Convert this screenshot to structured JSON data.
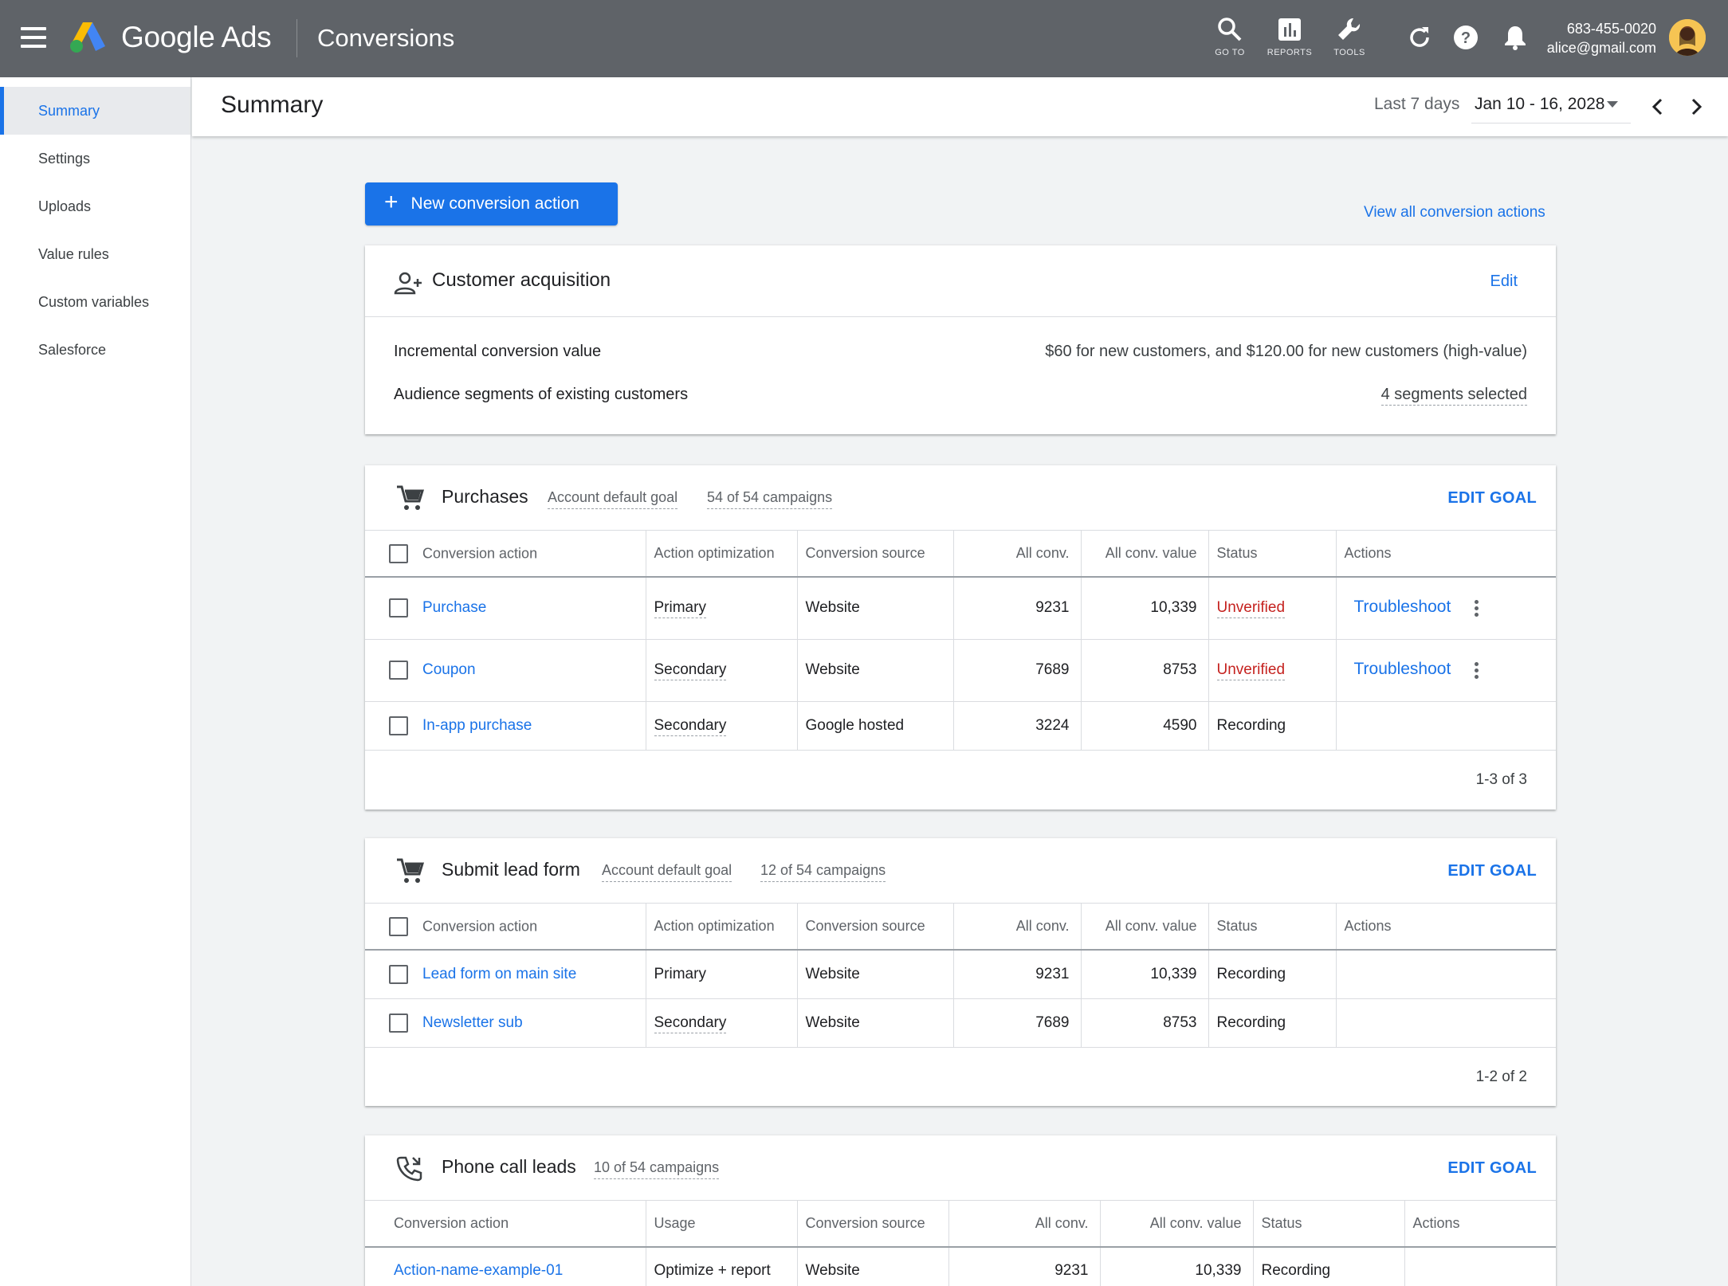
{
  "app": {
    "brand": "Google Ads",
    "section": "Conversions"
  },
  "topbar": {
    "tools": [
      {
        "label": "GO TO",
        "icon": "search-icon"
      },
      {
        "label": "REPORTS",
        "icon": "reports-icon"
      },
      {
        "label": "TOOLS",
        "icon": "wrench-icon"
      }
    ],
    "account": {
      "phone": "683-455-0020",
      "email": "alice@gmail.com"
    }
  },
  "sidebar": {
    "items": [
      {
        "label": "Summary",
        "active": true
      },
      {
        "label": "Settings"
      },
      {
        "label": "Uploads"
      },
      {
        "label": "Value rules"
      },
      {
        "label": "Custom variables"
      },
      {
        "label": "Salesforce"
      }
    ]
  },
  "header": {
    "title": "Summary",
    "date_label": "Last 7 days",
    "date_range": "Jan 10 - 16, 2028"
  },
  "main": {
    "new_button": "New conversion action",
    "view_all": "View all conversion actions"
  },
  "customer_acquisition": {
    "title": "Customer acquisition",
    "edit": "Edit",
    "rows": [
      {
        "label": "Incremental conversion value",
        "value": "$60 for new customers, and $120.00 for new customers (high-value)"
      },
      {
        "label": "Audience segments of existing customers",
        "value": "4 segments selected"
      }
    ]
  },
  "purchases": {
    "title": "Purchases",
    "chip1": "Account default goal",
    "chip2": "54 of 54 campaigns",
    "edit_goal": "EDIT GOAL",
    "columns": [
      "Conversion action",
      "Action optimization",
      "Conversion source",
      "All conv.",
      "All conv. value",
      "Status",
      "Actions"
    ],
    "rows": [
      {
        "action": "Purchase",
        "optimization": "Primary",
        "source": "Website",
        "conv": "9231",
        "value": "10,339",
        "status": "Unverified",
        "actions": "Troubleshoot"
      },
      {
        "action": "Coupon",
        "optimization": "Secondary",
        "source": "Website",
        "conv": "7689",
        "value": "8753",
        "status": "Unverified",
        "actions": "Troubleshoot"
      },
      {
        "action": "In-app purchase",
        "optimization": "Secondary",
        "source": "Google hosted",
        "conv": "3224",
        "value": "4590",
        "status": "Recording",
        "actions": ""
      }
    ],
    "pager": "1-3 of 3"
  },
  "lead_form": {
    "title": "Submit lead form",
    "chip1": "Account default goal",
    "chip2": "12 of 54 campaigns",
    "edit_goal": "EDIT GOAL",
    "columns": [
      "Conversion action",
      "Action optimization",
      "Conversion source",
      "All conv.",
      "All conv. value",
      "Status",
      "Actions"
    ],
    "rows": [
      {
        "action": "Lead form on main site",
        "optimization": "Primary",
        "source": "Website",
        "conv": "9231",
        "value": "10,339",
        "status": "Recording"
      },
      {
        "action": "Newsletter sub",
        "optimization": "Secondary",
        "source": "Website",
        "conv": "7689",
        "value": "8753",
        "status": "Recording"
      }
    ],
    "pager": "1-2 of 2"
  },
  "phone_leads": {
    "title": "Phone call leads",
    "chip1": "10 of 54 campaigns",
    "edit_goal": "EDIT GOAL",
    "columns": [
      "Conversion action",
      "Usage",
      "Conversion source",
      "All conv.",
      "All conv. value",
      "Status",
      "Actions"
    ],
    "rows": [
      {
        "action": "Action-name-example-01",
        "usage": "Optimize + report",
        "source": "Website",
        "conv": "9231",
        "value": "10,339",
        "status": "Recording"
      }
    ]
  }
}
